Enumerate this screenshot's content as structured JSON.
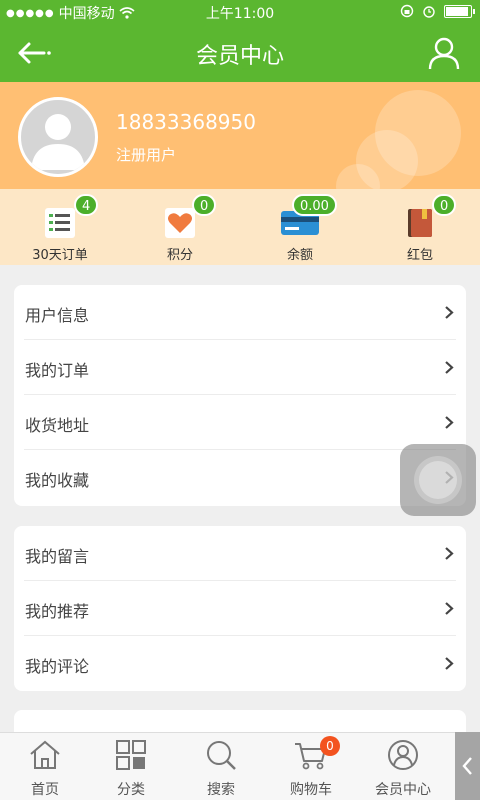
{
  "status_bar": {
    "carrier": "中国移动",
    "time": "上午11:00"
  },
  "header": {
    "title": "会员中心"
  },
  "profile": {
    "phone": "18833368950",
    "role": "注册用户"
  },
  "stats": [
    {
      "label": "30天订单",
      "badge": "4"
    },
    {
      "label": "积分",
      "badge": "0"
    },
    {
      "label": "余额",
      "badge": "0.00"
    },
    {
      "label": "红包",
      "badge": "0"
    }
  ],
  "menu_group_1": [
    "用户信息",
    "我的订单",
    "收货地址",
    "我的收藏"
  ],
  "menu_group_2": [
    "我的留言",
    "我的推荐",
    "我的评论"
  ],
  "tabbar": {
    "items": [
      "首页",
      "分类",
      "搜索",
      "购物车",
      "会员中心"
    ],
    "cart_badge": "0"
  },
  "colors": {
    "brand_green": "#5bb730",
    "banner_orange": "#ffbf73",
    "badge_green": "#4caf2a",
    "cart_badge": "#f3531f"
  }
}
